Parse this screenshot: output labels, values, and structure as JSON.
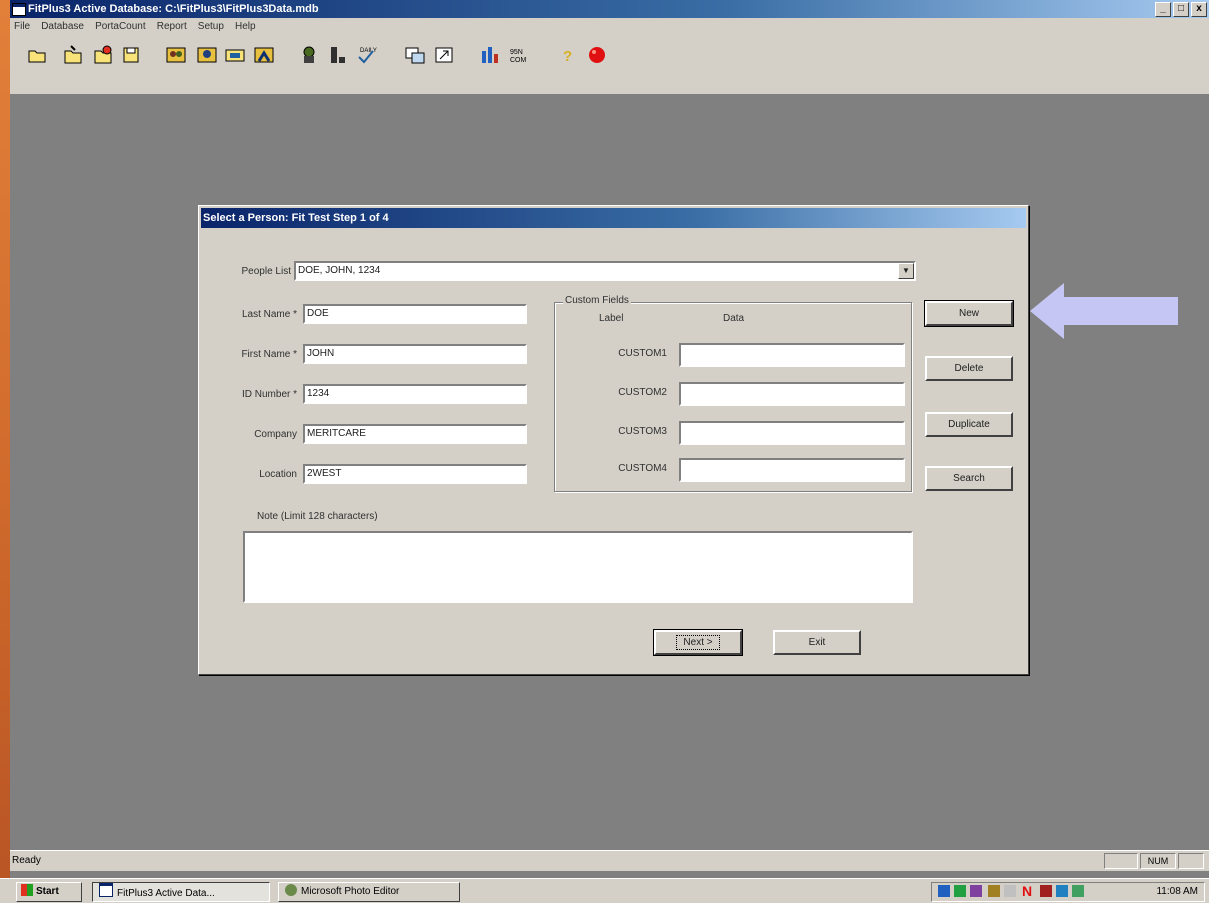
{
  "app": {
    "title": "FitPlus3   Active Database: C:\\FitPlus3\\FitPlus3Data.mdb",
    "window_buttons": [
      "_",
      "□",
      "x"
    ],
    "menu": [
      "File",
      "Database",
      "PortaCount",
      "Report",
      "Setup",
      "Help"
    ],
    "toolbar_icons": [
      "open-folder-icon",
      "new-folder-icon",
      "open-record-icon",
      "save-disk-icon",
      "people-icon",
      "people-group-icon",
      "folder-card-icon",
      "person-run-icon",
      "respirator-icon",
      "fit-test-icon",
      "daily-check-icon",
      "data-transfer-icon",
      "export-icon",
      "bar-chart-icon",
      "n95-companion-icon",
      "help-icon",
      "stop-red-icon"
    ],
    "status": {
      "ready": "Ready",
      "num": "NUM"
    }
  },
  "dialog": {
    "title": "Select a Person: Fit Test Step 1 of 4",
    "people_list_label": "People List",
    "people_list_value": "DOE, JOHN, 1234",
    "fields": {
      "last_name_label": "Last Name *",
      "last_name_value": "DOE",
      "first_name_label": "First Name *",
      "first_name_value": "JOHN",
      "id_label": "ID Number *",
      "id_value": "1234",
      "company_label": "Company",
      "company_value": "MERITCARE",
      "location_label": "Location",
      "location_value": "2WEST"
    },
    "custom": {
      "legend": "Custom Fields",
      "col_label": "Label",
      "col_data": "Data",
      "rows": [
        "CUSTOM1",
        "CUSTOM2",
        "CUSTOM3",
        "CUSTOM4"
      ]
    },
    "note_label": "Note (Limit 128 characters)",
    "buttons": {
      "new": "New",
      "delete": "Delete",
      "duplicate": "Duplicate",
      "search": "Search",
      "next": "Next >",
      "exit": "Exit"
    }
  },
  "taskbar": {
    "start": "Start",
    "items": [
      "FitPlus3   Active Data...",
      "Microsoft Photo Editor"
    ],
    "clock": "11:08 AM"
  },
  "colors": {
    "arrow": "#c6c6f4",
    "title_blue": "#0a246a",
    "face": "#d4d0c8",
    "backdrop": "#d96f2f"
  }
}
